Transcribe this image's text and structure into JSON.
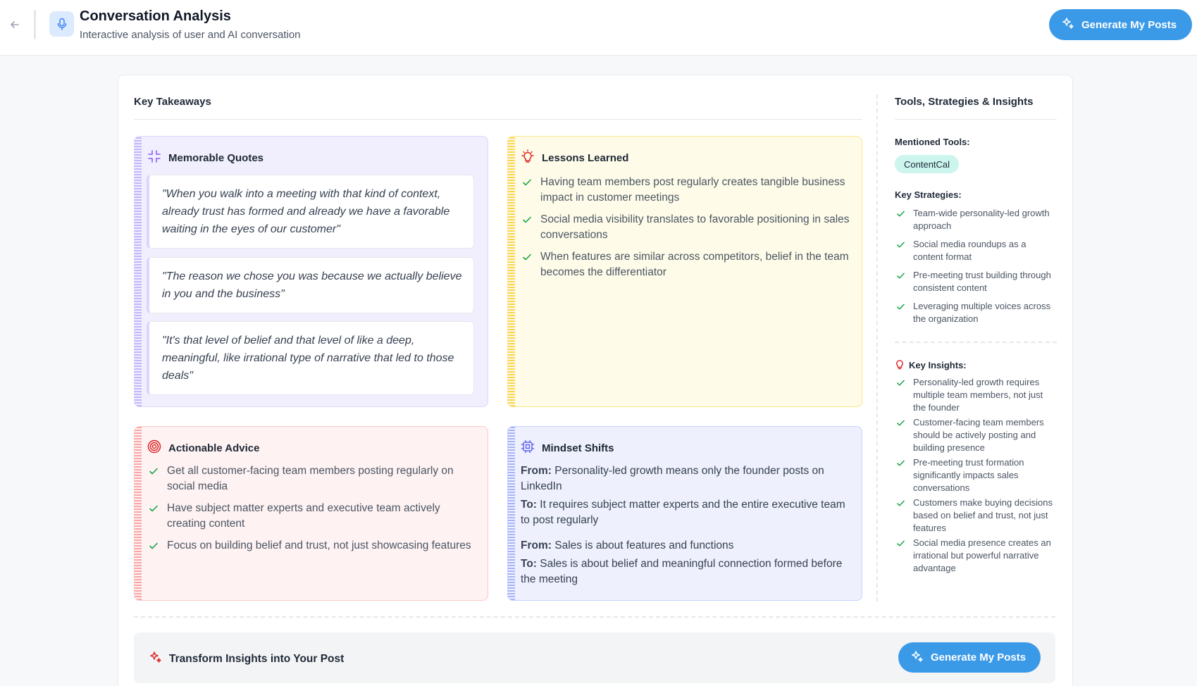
{
  "header": {
    "title": "Conversation Analysis",
    "subtitle": "Interactive analysis of user and AI conversation",
    "generate_label": "Generate My Posts"
  },
  "key_takeaways": {
    "title": "Key Takeaways",
    "memorable_quotes": {
      "title": "Memorable Quotes",
      "items": [
        "\"When you walk into a meeting with that kind of context, already trust has formed and already we have a favorable waiting in the eyes of our customer\"",
        "\"The reason we chose you was because we actually believe in you and the business\"",
        "\"It's that level of belief and that level of like a deep, meaningful, like irrational type of narrative that led to those deals\""
      ]
    },
    "lessons_learned": {
      "title": "Lessons Learned",
      "items": [
        "Having team members post regularly creates tangible business impact in customer meetings",
        "Social media visibility translates to favorable positioning in sales conversations",
        "When features are similar across competitors, belief in the team becomes the differentiator"
      ]
    },
    "actionable_advice": {
      "title": "Actionable Advice",
      "items": [
        "Get all customer-facing team members posting regularly on social media",
        "Have subject matter experts and executive team actively creating content",
        "Focus on building belief and trust, not just showcasing features"
      ]
    },
    "mindset_shifts": {
      "title": "Mindset Shifts",
      "from_label": "From:",
      "to_label": "To:",
      "items": [
        {
          "from": "Personality-led growth means only the founder posts on LinkedIn",
          "to": "It requires subject matter experts and the entire executive team to post regularly"
        },
        {
          "from": "Sales is about features and functions",
          "to": "Sales is about belief and meaningful connection formed before the meeting"
        }
      ]
    }
  },
  "sidebar": {
    "title": "Tools, Strategies & Insights",
    "tools_label": "Mentioned Tools:",
    "tools": [
      "ContentCal"
    ],
    "strategies_label": "Key Strategies:",
    "strategies": [
      "Team-wide personality-led growth approach",
      "Social media roundups as a content format",
      "Pre-meeting trust building through consistent content",
      "Leveraging multiple voices across the organization"
    ],
    "insights_label": "Key Insights:",
    "insights": [
      "Personality-led growth requires multiple team members, not just the founder",
      "Customer-facing team members should be actively posting and building presence",
      "Pre-meeting trust formation significantly impacts sales conversations",
      "Customers make buying decisions based on belief and trust, not just features",
      "Social media presence creates an irrational but powerful narrative advantage"
    ]
  },
  "transform": {
    "label": "Transform Insights into Your Post",
    "button_label": "Generate My Posts"
  },
  "colors": {
    "accent": "#3b9ae8",
    "check": "#16a34a",
    "chip_bg": "#ccf5ee"
  },
  "icons": {
    "back": "arrow-left-icon",
    "mic": "microphone-icon",
    "sparkles": "sparkles-icon",
    "quotes": "shrink-icon",
    "lessons": "lightbulb-icon",
    "advice": "target-icon",
    "mindset": "cpu-icon",
    "check": "check-icon"
  }
}
